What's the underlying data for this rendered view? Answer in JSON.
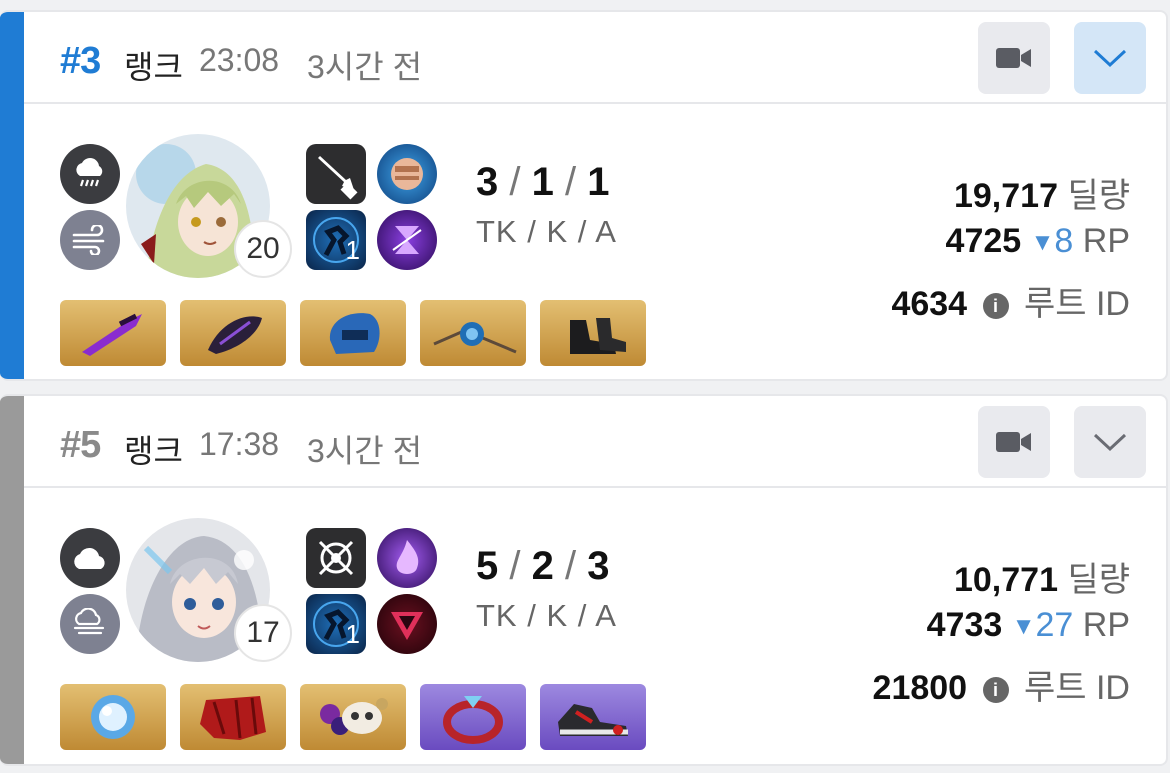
{
  "matches": [
    {
      "rank": "#3",
      "mode": "랭크",
      "time": "23:08",
      "ago": "3시간 전",
      "accent_color": "#1f7cd4",
      "expanded": true,
      "level": "20",
      "skill_count": "1",
      "kda": {
        "tk": "3",
        "k": "1",
        "a": "1",
        "sep": "/",
        "label": "TK / K / A"
      },
      "damage": {
        "value": "19,717",
        "unit": "딜량"
      },
      "rp": {
        "value": "4725",
        "arrow": "▼",
        "delta": "8",
        "unit": "RP"
      },
      "route": {
        "value": "4634",
        "icon": "i",
        "unit": "루트 ID"
      },
      "weather": [
        "rain-cloud-icon",
        "wind-icon"
      ],
      "items": [
        "gold",
        "gold",
        "gold",
        "gold",
        "gold"
      ]
    },
    {
      "rank": "#5",
      "mode": "랭크",
      "time": "17:38",
      "ago": "3시간 전",
      "accent_color": "#9a9a9a",
      "expanded": false,
      "level": "17",
      "skill_count": "1",
      "kda": {
        "tk": "5",
        "k": "2",
        "a": "3",
        "sep": "/",
        "label": "TK / K / A"
      },
      "damage": {
        "value": "10,771",
        "unit": "딜량"
      },
      "rp": {
        "value": "4733",
        "arrow": "▼",
        "delta": "27",
        "unit": "RP"
      },
      "route": {
        "value": "21800",
        "icon": "i",
        "unit": "루트 ID"
      },
      "weather": [
        "cloud-icon",
        "fog-wind-icon"
      ],
      "items": [
        "gold",
        "gold",
        "gold",
        "purple",
        "purple"
      ]
    }
  ]
}
